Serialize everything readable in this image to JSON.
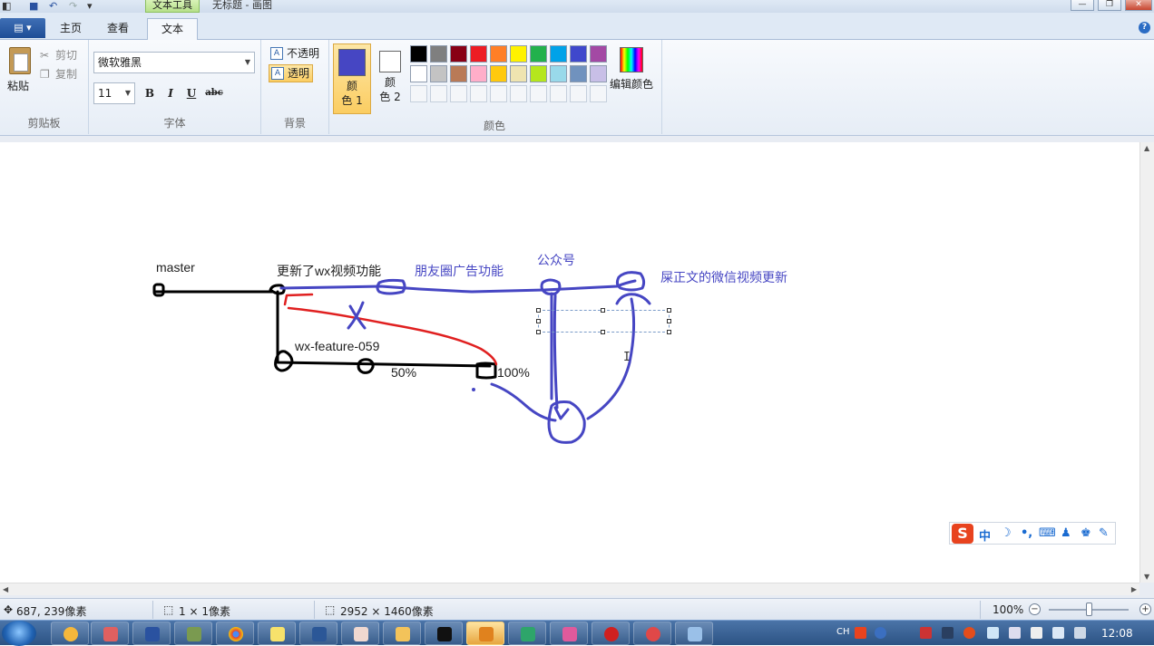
{
  "window": {
    "contextual_tab": "文本工具",
    "doc_title": "无标题 - 画图",
    "min": "—",
    "max": "❐",
    "close": "✕"
  },
  "tabs": {
    "file": "▤ ▾",
    "home": "主页",
    "view": "查看",
    "text": "文本",
    "help": "?"
  },
  "ribbon": {
    "clipboard": {
      "paste": "粘贴",
      "cut": "剪切",
      "copy": "复制",
      "group": "剪贴板"
    },
    "font": {
      "family": "微软雅黑",
      "size": "11",
      "bold": "B",
      "italic": "I",
      "underline": "U",
      "strike": "abc",
      "group": "字体"
    },
    "background": {
      "opaque": "不透明",
      "transparent": "透明",
      "group": "背景"
    },
    "colors": {
      "color1_l1": "颜",
      "color1_l2": "色 1",
      "color2_l1": "颜",
      "color2_l2": "色 2",
      "edit": "编辑颜色",
      "group": "颜色",
      "color1": "#4646c3",
      "color2": "#ffffff",
      "row1": [
        "#000000",
        "#7f7f7f",
        "#880015",
        "#ed1c24",
        "#ff7f27",
        "#fff200",
        "#22b14c",
        "#00a2e8",
        "#3f48cc",
        "#a349a4"
      ],
      "row2": [
        "#ffffff",
        "#c3c3c3",
        "#b97a57",
        "#ffaec9",
        "#ffc90e",
        "#efe4b0",
        "#b5e61d",
        "#99d9ea",
        "#7092be",
        "#c8bfe7"
      ]
    }
  },
  "canvas_labels": {
    "master": "master",
    "wx_updated": "更新了wx视频功能",
    "moments": "朋友圈广告功能",
    "official": "公众号",
    "pee": "屎正文的微信视频更新",
    "feature": "wx-feature-059",
    "p50": "50%",
    "p100": "100%"
  },
  "ime": {
    "cn": "中",
    "moon": "☽",
    "punct": "•,",
    "kbd": "⌨",
    "user": "♟",
    "shirt": "♚",
    "tool": "✎"
  },
  "status": {
    "cursor": "687, 239像素",
    "selection": "1 × 1像素",
    "size": "2952 × 1460像素",
    "zoom": "100%"
  },
  "taskbar": {
    "lang": "CH",
    "clock": "12:08"
  }
}
